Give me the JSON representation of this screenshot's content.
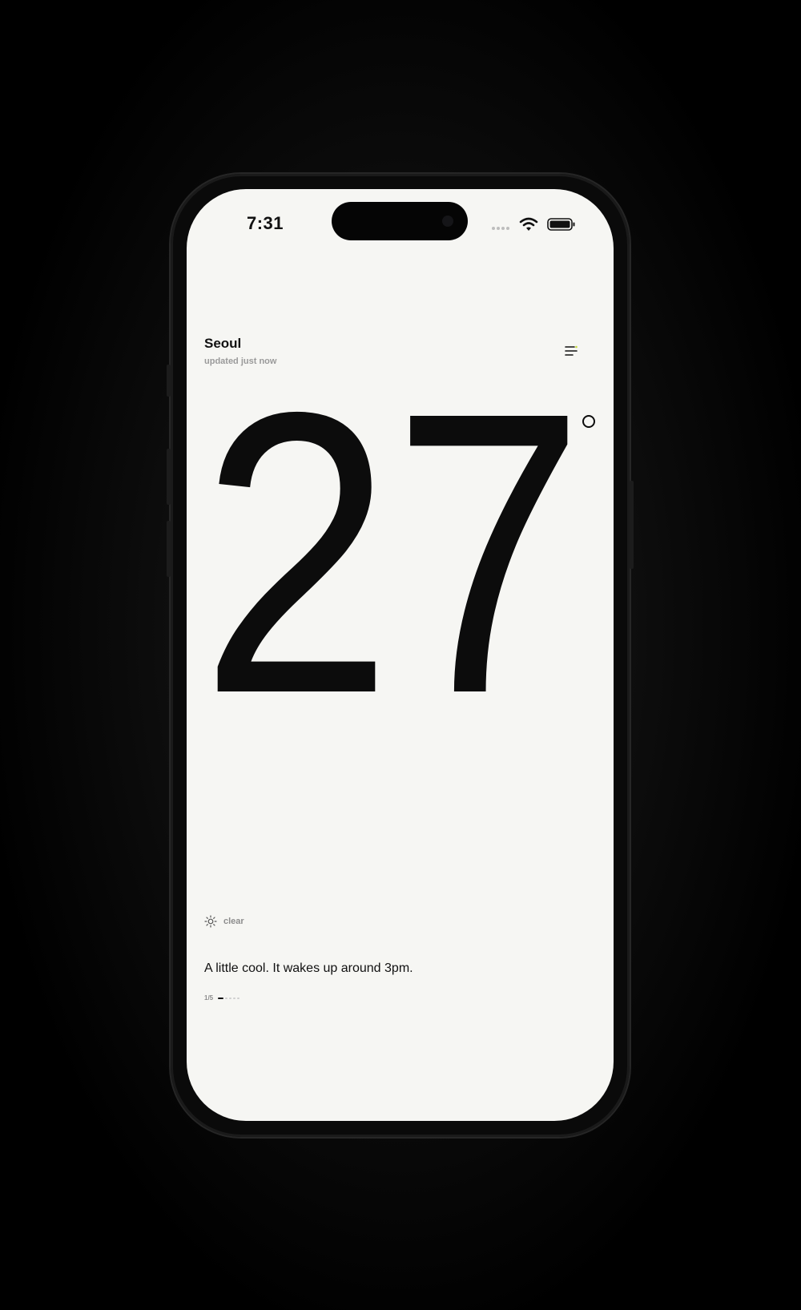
{
  "status_bar": {
    "time": "7:31"
  },
  "header": {
    "city": "Seoul",
    "updated": "updated just now",
    "menu_icon": "menu-lines-icon"
  },
  "weather": {
    "temperature": "27",
    "condition": "clear",
    "condition_icon": "sun-icon",
    "description": "A little cool. It wakes up around 3pm."
  },
  "pager": {
    "label": "1/5",
    "current": 1,
    "total": 5
  },
  "colors": {
    "background": "#f6f6f3",
    "text": "#0c0c0c",
    "muted": "#9a9a9a",
    "accent": "#c6dc3a"
  }
}
